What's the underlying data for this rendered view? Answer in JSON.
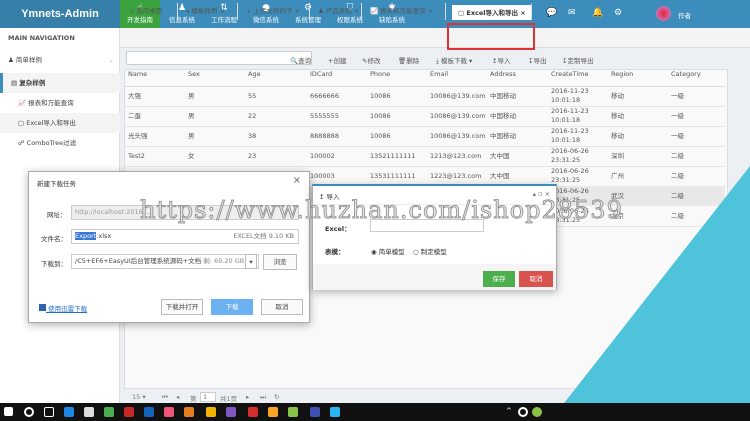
{
  "app": {
    "title": "Ymnets-Admin",
    "user": "作者"
  },
  "topnav": [
    {
      "label": "开发指南",
      "icon": "hand-pointer-icon"
    },
    {
      "label": "信息系统",
      "icon": "sitemap-icon"
    },
    {
      "label": "工作流程",
      "icon": "sort-icon"
    },
    {
      "label": "微信系统",
      "icon": "wechat-icon"
    },
    {
      "label": "系统管理",
      "icon": "gears-icon"
    },
    {
      "label": "权限系统",
      "icon": "shield-icon"
    },
    {
      "label": "缺陷系统",
      "icon": "bug-icon"
    }
  ],
  "sidebar": {
    "heading": "MAIN NAVIGATION",
    "items": [
      {
        "label": "简单样例"
      },
      {
        "label": "复杂样例"
      },
      {
        "label": "报表和万能查询"
      },
      {
        "label": "Excel导入和导出"
      },
      {
        "label": "ComboTree过滤"
      }
    ]
  },
  "tabs": [
    {
      "label": "我的桌面"
    },
    {
      "label": "模板样例"
    },
    {
      "label": "上传文件例子"
    },
    {
      "label": "产品类别"
    },
    {
      "label": "报表和万能查询"
    },
    {
      "label": "Excel导入和导出"
    }
  ],
  "toolbar": {
    "query": "查询",
    "create": "创建",
    "edit": "修改",
    "delete": "删除",
    "template": "模板下载",
    "import": "导入",
    "export": "导出",
    "custom_export": "定制导出"
  },
  "table": {
    "columns": [
      "Name",
      "Sex",
      "Age",
      "IDCard",
      "Phone",
      "Email",
      "Address",
      "CreateTime",
      "Region",
      "Category"
    ],
    "rows": [
      [
        "大强",
        "男",
        "55",
        "6666666",
        "10086",
        "10086@139.com",
        "中国移动",
        "2016-11-23",
        "10:01:18",
        "移动",
        "一级"
      ],
      [
        "二蛋",
        "男",
        "22",
        "5555555",
        "10086",
        "10086@139.com",
        "中国移动",
        "2016-11-23",
        "10:01:18",
        "移动",
        "一级"
      ],
      [
        "光头强",
        "男",
        "38",
        "8888888",
        "10086",
        "10086@139.com",
        "中国移动",
        "2016-11-23",
        "10:01:18",
        "移动",
        "一级"
      ],
      [
        "Test2",
        "女",
        "23",
        "100002",
        "13521111111",
        "1213@123.com",
        "大中国",
        "2016-06-26",
        "23:31:25",
        "深圳",
        "二级"
      ],
      [
        "",
        "",
        "",
        "100003",
        "13531111111",
        "1223@123.com",
        "大中国",
        "2016-06-26",
        "23:31:25",
        "广州",
        "二级"
      ],
      [
        "",
        "",
        "",
        "",
        "",
        "",
        "",
        "2016-06-26",
        "23:31:25",
        "武汉",
        "二级"
      ],
      [
        "",
        "",
        "",
        "",
        "",
        "",
        "",
        "2016-06-26",
        "23:31:25",
        "北京",
        "二级"
      ]
    ]
  },
  "pager": {
    "page_size": "15",
    "page_prefix": "第",
    "page": "1",
    "total": "共1页"
  },
  "download_dialog": {
    "title": "新建下载任务",
    "url_label": "网址：",
    "url": "http://localhost:2016/...",
    "file_label": "文件名：",
    "file_sel": "Export",
    "file_rest": ".xlsx",
    "file_info": "EXCEL文档 9.10 KB",
    "dest_label": "下载到：",
    "dest": "/C5+EF6+EasyUI后台管理系统源码+文档",
    "free": "剩: 69.20 GB",
    "browse": "浏览",
    "thunder": "使用迅雷下载",
    "open_btn": "下载并打开",
    "download_btn": "下载",
    "cancel_btn": "取消"
  },
  "import_dialog": {
    "title": "导入",
    "excel_label": "Excel：",
    "model_label": "表模：",
    "opt1": "简单模型",
    "opt2": "制定模型",
    "save": "保存",
    "cancel": "取消"
  },
  "watermark": "https://www.huzhan.com/ishop28539"
}
